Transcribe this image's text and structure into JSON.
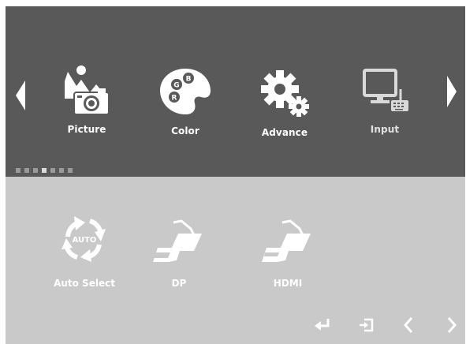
{
  "menu": {
    "items": [
      {
        "label": "Picture",
        "icon": "picture-icon"
      },
      {
        "label": "Color",
        "icon": "color-palette-icon",
        "palette_letters": [
          "B",
          "G",
          "R"
        ]
      },
      {
        "label": "Advance",
        "icon": "gears-icon"
      },
      {
        "label": "Input",
        "icon": "monitor-input-icon"
      }
    ],
    "page_indicator": {
      "total": 7,
      "active": 4
    }
  },
  "submenu": {
    "items": [
      {
        "label": "Auto Select",
        "icon": "auto-select-icon",
        "badge": "AUTO"
      },
      {
        "label": "DP",
        "icon": "displayport-connector-icon"
      },
      {
        "label": "HDMI",
        "icon": "hdmi-connector-icon"
      }
    ]
  },
  "nav_buttons": [
    "enter-icon",
    "exit-icon",
    "left-arrow-icon",
    "right-arrow-icon"
  ],
  "colors": {
    "header_bg": "#595959",
    "panel_bg": "#c9c9c9",
    "icon": "#ffffff",
    "dot": "#9a9a9a",
    "dot_active": "#dcdcdc"
  }
}
